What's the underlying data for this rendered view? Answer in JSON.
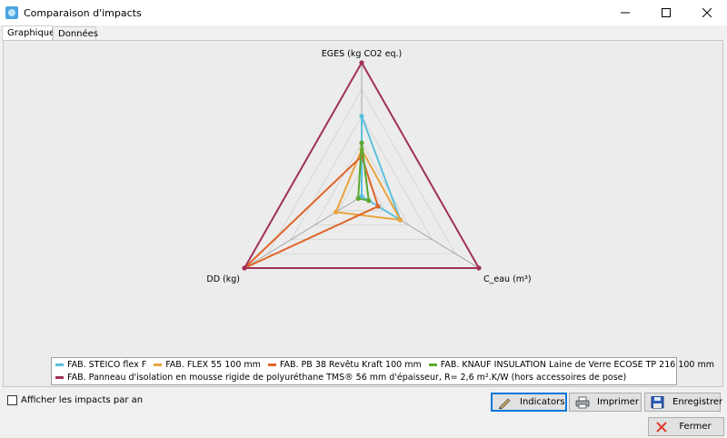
{
  "window": {
    "title": "Comparaison d'impacts"
  },
  "tabs": [
    {
      "label": "Graphique",
      "active": true
    },
    {
      "label": "Données",
      "active": false
    }
  ],
  "chart_data": {
    "type": "radar",
    "axes": [
      "EGES (kg CO2 eq.)",
      "C_eau (m³)",
      "DD (kg)"
    ],
    "range": [
      0,
      1
    ],
    "grid_levels": 5,
    "series": [
      {
        "name": "FAB. STEICO flex F",
        "color": "#5bc0de",
        "values": [
          0.6,
          0.33,
          0.0
        ]
      },
      {
        "name": "FAB. FLEX 55 100 mm",
        "color": "#e8a33c",
        "values": [
          0.35,
          0.33,
          0.22
        ]
      },
      {
        "name": "FAB. PB 38 Revêtu Kraft 100 mm",
        "color": "#e06428",
        "values": [
          0.3,
          0.14,
          1.0
        ]
      },
      {
        "name": "FAB. KNAUF INSULATION Laine de Verre ECOSE TP 216 100 mm",
        "color": "#5aa832",
        "values": [
          0.4,
          0.06,
          0.03
        ]
      },
      {
        "name": "FAB. Panneau d'isolation en mousse rigide de polyuréthane TMS® 56 mm d'épaisseur, R= 2,6 m².K/W (hors accessoires de pose)",
        "color": "#a0305a",
        "values": [
          1.0,
          1.0,
          1.0
        ]
      }
    ]
  },
  "legend": {
    "row1": [
      0,
      1,
      2,
      3
    ],
    "row2": [
      4
    ]
  },
  "options": {
    "per_year_label": "Afficher les impacts par an",
    "per_year_checked": false
  },
  "buttons": {
    "indicators": "Indicators",
    "print": "Imprimer",
    "save": "Enregistrer",
    "close": "Fermer"
  },
  "colors": {
    "accent": "#0078d7",
    "close_x": "#e03c31"
  }
}
